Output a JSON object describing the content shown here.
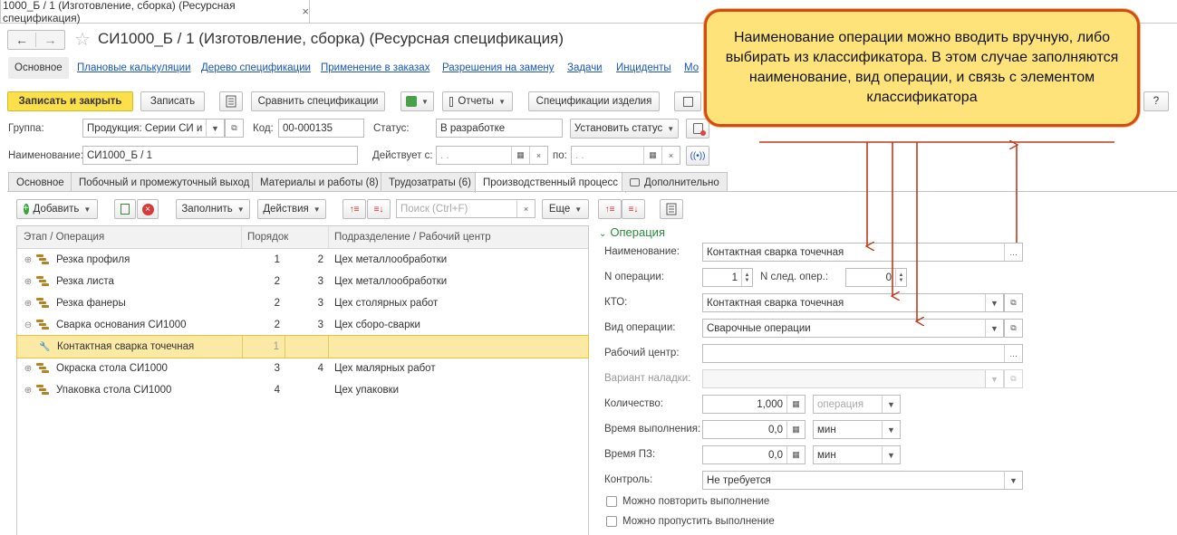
{
  "window_tab": {
    "title": "1000_Б / 1 (Изготовление, сборка) (Ресурсная спецификация)",
    "close": "×"
  },
  "header": {
    "title": "СИ1000_Б / 1 (Изготовление, сборка) (Ресурсная спецификация)",
    "back": "←",
    "forward": "→",
    "star": "☆",
    "help": "?"
  },
  "nav_links": [
    {
      "label": "Основное",
      "active": true
    },
    {
      "label": "Плановые калькуляции"
    },
    {
      "label": "Дерево спецификации"
    },
    {
      "label": "Применение в заказах"
    },
    {
      "label": "Разрешения на замену"
    },
    {
      "label": "Задачи"
    },
    {
      "label": "Инциденты"
    },
    {
      "label": "Мо"
    }
  ],
  "toolbar": {
    "save_close": "Записать и закрыть",
    "save": "Записать",
    "compare": "Сравнить спецификации",
    "reports": "Отчеты",
    "product_specs": "Спецификации изделия"
  },
  "form": {
    "group_label": "Группа:",
    "group_value": "Продукция: Серии СИ и Т",
    "code_label": "Код:",
    "code_value": "00-000135",
    "status_label": "Статус:",
    "status_value": "В разработке",
    "set_status": "Установить статус",
    "name_label": "Наименование:",
    "name_value": "СИ1000_Б / 1",
    "valid_from_label": "Действует с:",
    "valid_from_value": " .  .",
    "valid_to_label": "по:",
    "valid_to_value": " .  ."
  },
  "tabs": [
    "Основное",
    "Побочный и промежуточный выход",
    "Материалы и работы (8)",
    "Трудозатраты (6)",
    "Производственный процесс",
    "Дополнительно"
  ],
  "table_toolbar": {
    "add": "Добавить",
    "fill": "Заполнить",
    "actions": "Действия",
    "search_placeholder": "Поиск (Ctrl+F)",
    "more": "Еще"
  },
  "table": {
    "headers": [
      "Этап / Операция",
      "Порядок",
      "",
      "Подразделение / Рабочий центр"
    ],
    "rows": [
      {
        "name": "Резка профиля",
        "order": "1",
        "next": "2",
        "dept": "Цех металлообработки",
        "exp": "⊕",
        "level": 0
      },
      {
        "name": "Резка листа",
        "order": "2",
        "next": "3",
        "dept": "Цех металлообработки",
        "exp": "⊕",
        "level": 0
      },
      {
        "name": "Резка фанеры",
        "order": "2",
        "next": "3",
        "dept": "Цех столярных работ",
        "exp": "⊕",
        "level": 0
      },
      {
        "name": "Сварка основания СИ1000",
        "order": "2",
        "next": "3",
        "dept": "Цех сборо-сварки",
        "exp": "⊖",
        "level": 0
      },
      {
        "name": "Контактная сварка точечная",
        "order": "1",
        "next": "",
        "dept": "",
        "exp": "",
        "level": 1,
        "selected": true
      },
      {
        "name": "Окраска стола СИ1000",
        "order": "3",
        "next": "4",
        "dept": "Цех малярных работ",
        "exp": "⊕",
        "level": 0
      },
      {
        "name": "Упаковка стола СИ1000",
        "order": "4",
        "next": "",
        "dept": "Цех упаковки",
        "exp": "⊕",
        "level": 0
      }
    ]
  },
  "operation": {
    "section_title": "Операция",
    "name_label": "Наименование:",
    "name_value": "Контактная сварка точечная",
    "num_label": "N операции:",
    "num_value": "1",
    "next_label": "N след. опер.:",
    "next_value": "0",
    "kto_label": "КТО:",
    "kto_value": "Контактная сварка точечная",
    "type_label": "Вид операции:",
    "type_value": "Сварочные операции",
    "center_label": "Рабочий центр:",
    "center_value": "",
    "setup_label": "Вариант наладки:",
    "setup_value": "",
    "qty_label": "Количество:",
    "qty_value": "1,000",
    "qty_unit": "операция",
    "exec_label": "Время выполнения:",
    "exec_value": "0,0",
    "exec_unit": "мин",
    "pz_label": "Время ПЗ:",
    "pz_value": "0,0",
    "pz_unit": "мин",
    "control_label": "Контроль:",
    "control_value": "Не требуется",
    "repeat_label": "Можно повторить выполнение",
    "skip_label": "Можно пропустить выполнение"
  },
  "callout": {
    "text": "Наименование  операции  можно вводить вручную, либо выбирать из классификатора.  В этом случае  заполняются  наименование,  вид операции,  и связь с элементом классификатора"
  },
  "colors": {
    "accent_yellow": "#fbe04a",
    "link": "#1a56b8",
    "callout_border": "#d24b10",
    "callout_fill": "#fde37a",
    "section_green": "#2a8a3c"
  }
}
